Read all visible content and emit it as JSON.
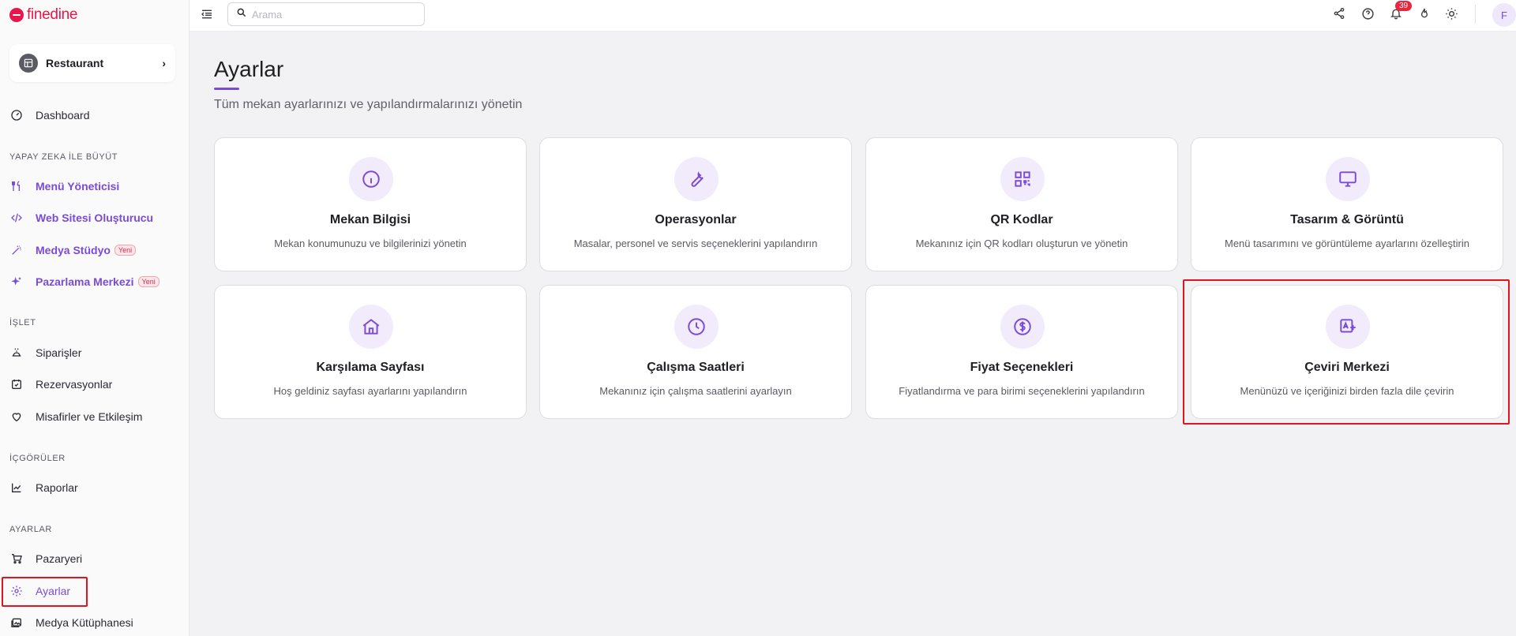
{
  "brand": {
    "name": "finedine",
    "color": "#e8174b"
  },
  "venue": {
    "label": "Restaurant"
  },
  "sidebar": {
    "dashboard": "Dashboard",
    "section_ai": "YAPAY ZEKA İLE BÜYÜT",
    "menu_manager": "Menü Yöneticisi",
    "website_builder": "Web Sitesi Oluşturucu",
    "media_studio": "Medya Stüdyo",
    "marketing_center": "Pazarlama Merkezi",
    "new_badge": "Yeni",
    "section_operate": "İŞLET",
    "orders": "Siparişler",
    "reservations": "Rezervasyonlar",
    "guests": "Misafirler ve Etkileşim",
    "section_insights": "İÇGÖRÜLER",
    "reports": "Raporlar",
    "section_settings": "AYARLAR",
    "marketplace": "Pazaryeri",
    "settings": "Ayarlar",
    "media_library": "Medya Kütüphanesi"
  },
  "topbar": {
    "search_placeholder": "Arama",
    "notification_count": "39",
    "avatar_initial": "F"
  },
  "page": {
    "title": "Ayarlar",
    "subtitle": "Tüm mekan ayarlarınızı ve yapılandırmalarınızı yönetin"
  },
  "cards": [
    {
      "title": "Mekan Bilgisi",
      "desc": "Mekan konumunuzu ve bilgilerinizi yönetin",
      "icon": "info-icon"
    },
    {
      "title": "Operasyonlar",
      "desc": "Masalar, personel ve servis seçeneklerini yapılandırın",
      "icon": "wrench-icon"
    },
    {
      "title": "QR Kodlar",
      "desc": "Mekanınız için QR kodları oluşturun ve yönetin",
      "icon": "qr-code-icon"
    },
    {
      "title": "Tasarım & Görüntü",
      "desc": "Menü tasarımını ve görüntüleme ayarlarını özelleştirin",
      "icon": "monitor-icon"
    },
    {
      "title": "Karşılama Sayfası",
      "desc": "Hoş geldiniz sayfası ayarlarını yapılandırın",
      "icon": "home-icon"
    },
    {
      "title": "Çalışma Saatleri",
      "desc": "Mekanınız için çalışma saatlerini ayarlayın",
      "icon": "clock-icon"
    },
    {
      "title": "Fiyat Seçenekleri",
      "desc": "Fiyatlandırma ve para birimi seçeneklerini yapılandırın",
      "icon": "dollar-icon"
    },
    {
      "title": "Çeviri Merkezi",
      "desc": "Menünüzü ve içeriğinizi birden fazla dile çevirin",
      "icon": "translate-icon"
    }
  ],
  "colors": {
    "accent": "#7a4bd6",
    "highlight": "#e2141f"
  }
}
